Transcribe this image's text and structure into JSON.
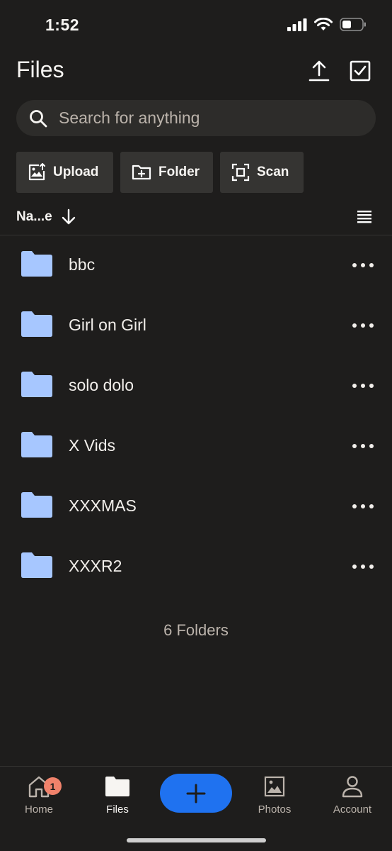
{
  "status_bar": {
    "time": "1:52"
  },
  "header": {
    "title": "Files"
  },
  "search": {
    "placeholder": "Search for anything"
  },
  "quick_actions": [
    {
      "label": "Upload",
      "icon": "upload-image-icon"
    },
    {
      "label": "Folder",
      "icon": "new-folder-icon"
    },
    {
      "label": "Scan",
      "icon": "scan-icon"
    }
  ],
  "sort": {
    "label": "Na...e",
    "direction": "descending"
  },
  "files": [
    {
      "name": "bbc",
      "icon": "folder-icon"
    },
    {
      "name": "Girl on Girl",
      "icon": "folder-icon"
    },
    {
      "name": "solo dolo",
      "icon": "folder-icon"
    },
    {
      "name": "X Vids",
      "icon": "folder-icon"
    },
    {
      "name": "XXXMAS",
      "icon": "folder-icon"
    },
    {
      "name": "XXXR2",
      "icon": "folder-icon"
    }
  ],
  "summary": {
    "folder_count": "6 Folders"
  },
  "tab_bar": {
    "home": {
      "label": "Home",
      "badge": "1"
    },
    "files": {
      "label": "Files"
    },
    "photos": {
      "label": "Photos"
    },
    "account": {
      "label": "Account"
    }
  },
  "colors": {
    "background": "#1e1d1c",
    "folder": "#a7c7ff",
    "accent": "#1f72f0",
    "badge": "#f0826b"
  }
}
